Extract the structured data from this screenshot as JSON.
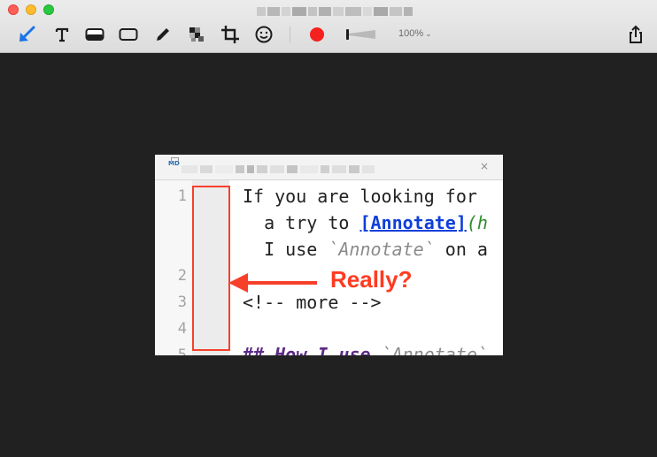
{
  "toolbar": {
    "tools": [
      {
        "name": "arrow-tool",
        "icon": "arrow-icon",
        "active": true
      },
      {
        "name": "text-tool",
        "icon": "text-icon",
        "glyph": "T"
      },
      {
        "name": "highlight-tool",
        "icon": "highlight-icon"
      },
      {
        "name": "rectangle-tool",
        "icon": "rectangle-icon"
      },
      {
        "name": "pen-tool",
        "icon": "pen-icon"
      },
      {
        "name": "pixelate-tool",
        "icon": "pixelate-icon"
      },
      {
        "name": "crop-tool",
        "icon": "crop-icon"
      },
      {
        "name": "emoji-tool",
        "icon": "emoji-icon"
      },
      {
        "name": "color-picker",
        "icon": "color-dot-icon"
      },
      {
        "name": "stroke-width-slider",
        "icon": "stroke-slider-icon"
      },
      {
        "name": "share-button",
        "icon": "share-icon"
      }
    ],
    "zoom_label": "100%",
    "zoom_chevron": "⌄",
    "accent_color": "#1a73e8",
    "record_color": "#f5211f"
  },
  "editor": {
    "tab_close": "×",
    "tab_icon_label": "MD",
    "line_numbers": [
      "1",
      "2",
      "3",
      "4",
      "5"
    ],
    "lines": {
      "l1": "If you are looking for",
      "l2_pre": "  a try to ",
      "l2_link": "[Annotate]",
      "l2_paren": "(h",
      "l3_pre": "  I use ",
      "l3_code": "`Annotate`",
      "l3_post": " on a",
      "l5": "<!-- more -->",
      "l7_heading": "## How I use ",
      "l7_code": "`Annotate`"
    }
  },
  "annotation": {
    "label": "Really?",
    "color": "#f7402a"
  }
}
